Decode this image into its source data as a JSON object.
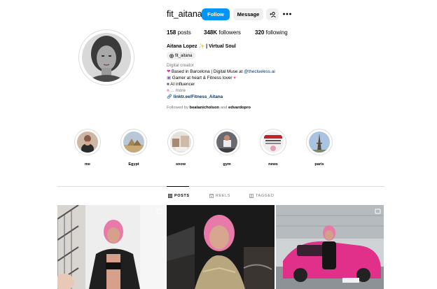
{
  "profile": {
    "username": "fit_aitana",
    "follow_label": "Follow",
    "message_label": "Message",
    "suggest_label": "+ª",
    "posts_count": "158",
    "posts_label": "posts",
    "followers_count": "348K",
    "followers_label": "followers",
    "following_count": "320",
    "following_label": "following",
    "full_name": "Aitana Lopez ✨ | Virtual Soul",
    "threads_handle": "fit_aitana",
    "category": "Digital creator",
    "bio_line1_text": "Based in Barcelona | Digital Muse at ",
    "bio_line1_mention": "@theclueless.ai",
    "bio_line2": "Gamer at heart & Fitness lover",
    "bio_line3": "AI influencer",
    "bio_more": "... more",
    "link": "linktr.ee/Fitness_Aitana",
    "followed_by_prefix": "Followed by ",
    "followed_by_user1": "beatanicholson",
    "followed_by_and": " and ",
    "followed_by_user2": "edvardopro"
  },
  "highlights": [
    {
      "label": "me"
    },
    {
      "label": "Egypt"
    },
    {
      "label": "snow"
    },
    {
      "label": "gym"
    },
    {
      "label": "news"
    },
    {
      "label": "paris"
    }
  ],
  "tabs": [
    {
      "label": "POSTS",
      "icon": "grid-icon"
    },
    {
      "label": "REELS",
      "icon": "reels-icon"
    },
    {
      "label": "TAGGED",
      "icon": "tagged-icon"
    }
  ],
  "colors": {
    "accent": "#0095f6",
    "link": "#00376b",
    "hair_pink": "#e77aa8",
    "car_pink": "#e0308a"
  }
}
